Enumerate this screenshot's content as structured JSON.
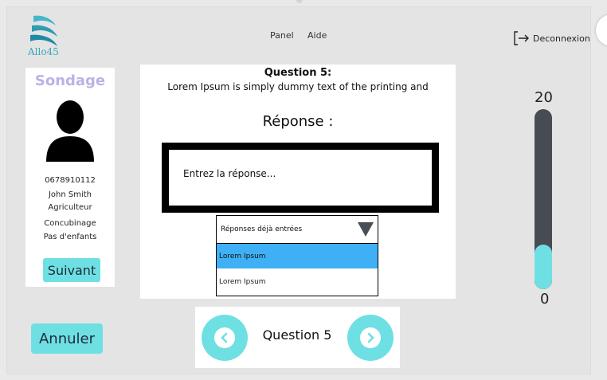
{
  "header": {
    "logo_text": "Allo45",
    "nav": {
      "panel": "Panel",
      "aide": "Aide"
    },
    "logout_label": "Deconnexion"
  },
  "profile": {
    "title": "Sondage",
    "phone": "0678910112",
    "name": "John Smith",
    "profession": "Agriculteur",
    "status": "Concubinage",
    "children": "Pas d'enfants",
    "next_button": "Suivant"
  },
  "question": {
    "title": "Question 5:",
    "text": "Lorem Ipsum is simply dummy text of the printing and",
    "response_label": "Réponse :",
    "answer_placeholder": "Entrez la réponse...",
    "dropdown": {
      "header": "Réponses déjà entrées",
      "options": [
        "Lorem Ipsum",
        "Lorem Ipsum"
      ],
      "selected_index": 0
    }
  },
  "pager": {
    "label": "Question 5"
  },
  "cancel_button": "Annuler",
  "slider": {
    "max": "20",
    "min": "0",
    "value_fraction": 0.25
  },
  "colors": {
    "accent": "#6ee0e4",
    "selected": "#3fb0f5",
    "title_purple": "#b8b3e8"
  }
}
